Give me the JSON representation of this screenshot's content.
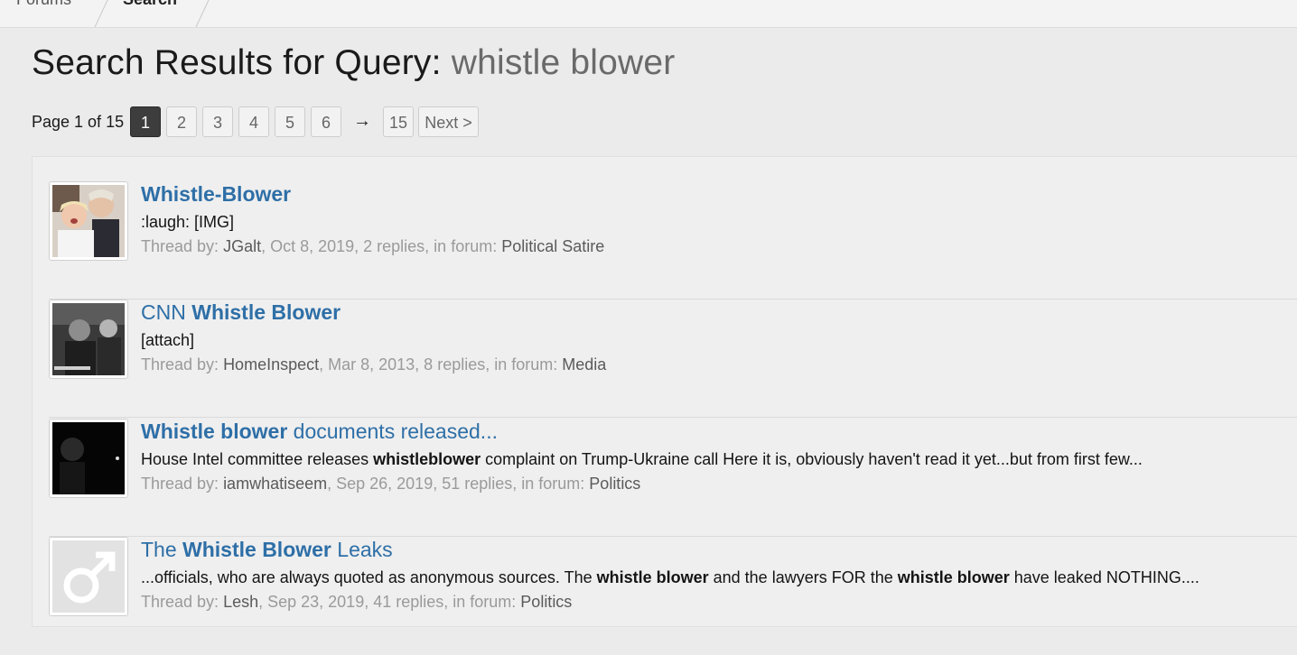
{
  "breadcrumb": {
    "forums": "Forums",
    "search": "Search"
  },
  "title": {
    "prefix": "Search Results for Query:",
    "query": "whistle blower"
  },
  "pagination": {
    "info": "Page 1 of 15",
    "pages": [
      "1",
      "2",
      "3",
      "4",
      "5",
      "6"
    ],
    "current": "1",
    "arrow": "→",
    "last": "15",
    "next": "Next >"
  },
  "results": [
    {
      "title_parts": [
        {
          "text": "Whistle-Blower",
          "bold": true
        }
      ],
      "snippet_parts": [
        {
          "text": ":laugh: [IMG]",
          "bold": false
        }
      ],
      "label": "Thread by:",
      "author": "JGalt",
      "date": ", Oct 8, 2019, 2 replies, in forum:",
      "forum": "Political Satire"
    },
    {
      "title_parts": [
        {
          "text": "CNN ",
          "bold": false
        },
        {
          "text": "Whistle Blower",
          "bold": true
        }
      ],
      "snippet_parts": [
        {
          "text": "[attach]",
          "bold": false
        }
      ],
      "label": "Thread by:",
      "author": "HomeInspect",
      "date": ", Mar 8, 2013, 8 replies, in forum:",
      "forum": "Media"
    },
    {
      "title_parts": [
        {
          "text": "Whistle blower",
          "bold": true
        },
        {
          "text": " documents released...",
          "bold": false
        }
      ],
      "snippet_parts": [
        {
          "text": "House Intel committee releases ",
          "bold": false
        },
        {
          "text": "whistleblower",
          "bold": true
        },
        {
          "text": " complaint on Trump-Ukraine call Here it is, obviously haven't read it yet...but from first few...",
          "bold": false
        }
      ],
      "label": "Thread by:",
      "author": "iamwhatiseem",
      "date": ", Sep 26, 2019, 51 replies, in forum:",
      "forum": "Politics"
    },
    {
      "title_parts": [
        {
          "text": "The ",
          "bold": false
        },
        {
          "text": "Whistle Blower",
          "bold": true
        },
        {
          "text": " Leaks",
          "bold": false
        }
      ],
      "snippet_parts": [
        {
          "text": "...officials, who are always quoted as anonymous sources. The ",
          "bold": false
        },
        {
          "text": "whistle blower",
          "bold": true
        },
        {
          "text": " and the lawyers FOR the ",
          "bold": false
        },
        {
          "text": "whistle blower",
          "bold": true
        },
        {
          "text": " have leaked NOTHING....",
          "bold": false
        }
      ],
      "label": "Thread by:",
      "author": "Lesh",
      "date": ", Sep 23, 2019, 41 replies, in forum:",
      "forum": "Politics"
    }
  ],
  "avatar_icons": [
    "photo-avatar-icon",
    "photo-avatar-icon",
    "photo-avatar-icon",
    "male-symbol-icon"
  ]
}
